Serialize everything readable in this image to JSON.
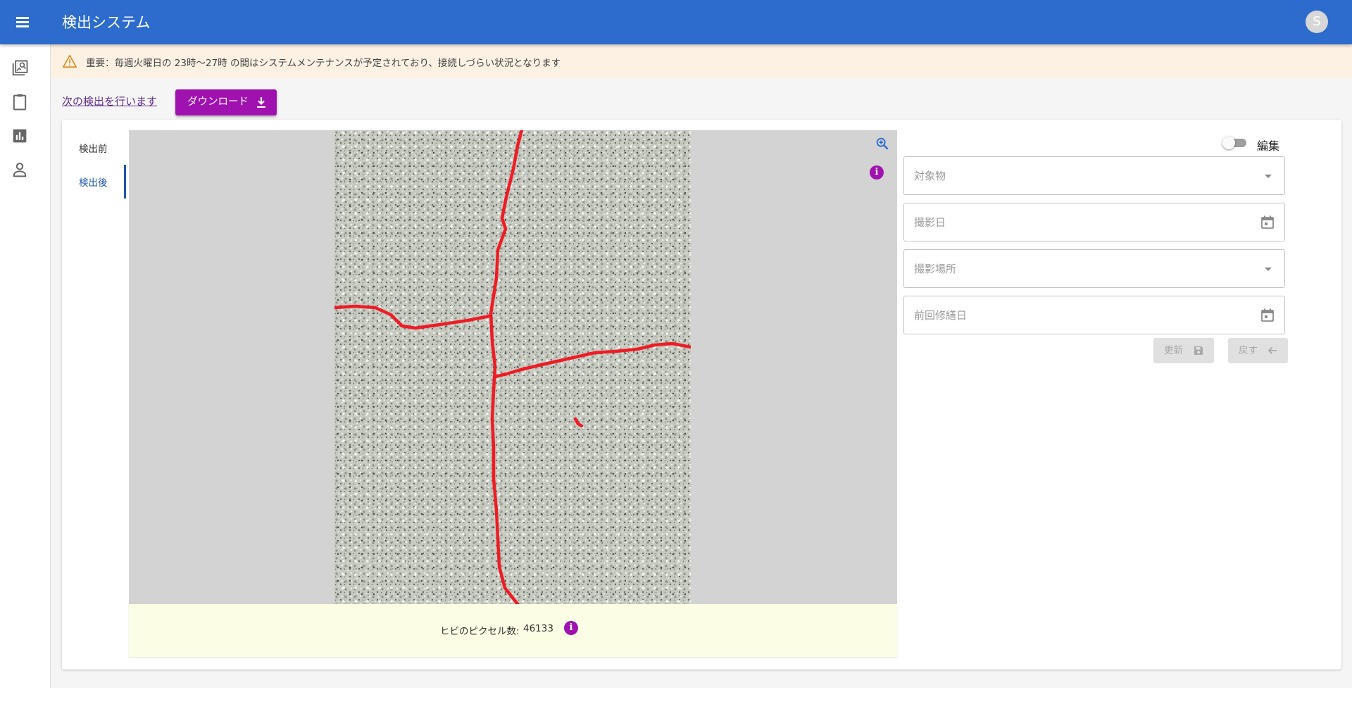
{
  "app": {
    "title": "検出システム",
    "avatar_initial": "S"
  },
  "nav_rail": {
    "items": [
      "image-search-icon",
      "clipboard-icon",
      "chart-icon",
      "person-icon"
    ]
  },
  "notice": {
    "icon": "warning-icon",
    "text": "重要：毎週火曜日の 23時～27時 の間はシステムメンテナンスが予定されており、接続しづらい状況となります"
  },
  "actions": {
    "next_link": "次の検出を行います",
    "download_label": "ダウンロード"
  },
  "tabs": [
    {
      "label": "検出前",
      "active": false
    },
    {
      "label": "検出後",
      "active": true
    }
  ],
  "viewer": {
    "zoom_icon": "zoom-in-icon",
    "info_icon_text": "i"
  },
  "result": {
    "label": "ヒビのピクセル数:",
    "value": "46133",
    "info_icon_text": "i"
  },
  "form": {
    "edit_label": "編集",
    "edit_enabled": false,
    "fields": {
      "target": "対象物",
      "shoot_date": "撮影日",
      "shoot_place": "撮影場所",
      "last_repair": "前回修繕日"
    },
    "update_label": "更新",
    "back_label": "戻す"
  },
  "colors": {
    "appbar": "#2d6ccc",
    "accent": "#a012b0",
    "crack": "#ee1c25",
    "notice_bg": "#fdf1e4",
    "result_bg": "#fbfde4"
  }
}
